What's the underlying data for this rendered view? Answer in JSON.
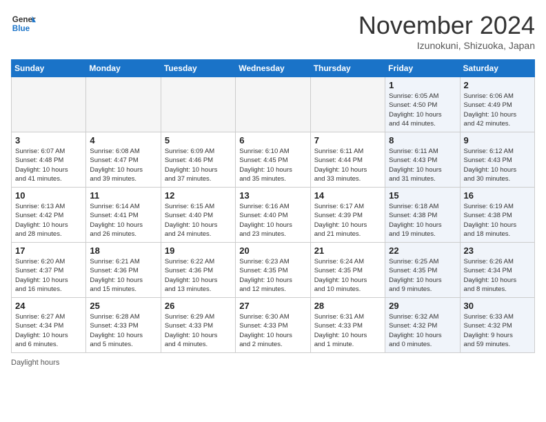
{
  "header": {
    "logo_line1": "General",
    "logo_line2": "Blue",
    "month": "November 2024",
    "location": "Izunokuni, Shizuoka, Japan"
  },
  "weekdays": [
    "Sunday",
    "Monday",
    "Tuesday",
    "Wednesday",
    "Thursday",
    "Friday",
    "Saturday"
  ],
  "weeks": [
    [
      {
        "day": "",
        "info": "",
        "empty": true
      },
      {
        "day": "",
        "info": "",
        "empty": true
      },
      {
        "day": "",
        "info": "",
        "empty": true
      },
      {
        "day": "",
        "info": "",
        "empty": true
      },
      {
        "day": "",
        "info": "",
        "empty": true
      },
      {
        "day": "1",
        "info": "Sunrise: 6:05 AM\nSunset: 4:50 PM\nDaylight: 10 hours\nand 44 minutes.",
        "shaded": true
      },
      {
        "day": "2",
        "info": "Sunrise: 6:06 AM\nSunset: 4:49 PM\nDaylight: 10 hours\nand 42 minutes.",
        "shaded": true
      }
    ],
    [
      {
        "day": "3",
        "info": "Sunrise: 6:07 AM\nSunset: 4:48 PM\nDaylight: 10 hours\nand 41 minutes."
      },
      {
        "day": "4",
        "info": "Sunrise: 6:08 AM\nSunset: 4:47 PM\nDaylight: 10 hours\nand 39 minutes."
      },
      {
        "day": "5",
        "info": "Sunrise: 6:09 AM\nSunset: 4:46 PM\nDaylight: 10 hours\nand 37 minutes."
      },
      {
        "day": "6",
        "info": "Sunrise: 6:10 AM\nSunset: 4:45 PM\nDaylight: 10 hours\nand 35 minutes."
      },
      {
        "day": "7",
        "info": "Sunrise: 6:11 AM\nSunset: 4:44 PM\nDaylight: 10 hours\nand 33 minutes."
      },
      {
        "day": "8",
        "info": "Sunrise: 6:11 AM\nSunset: 4:43 PM\nDaylight: 10 hours\nand 31 minutes.",
        "shaded": true
      },
      {
        "day": "9",
        "info": "Sunrise: 6:12 AM\nSunset: 4:43 PM\nDaylight: 10 hours\nand 30 minutes.",
        "shaded": true
      }
    ],
    [
      {
        "day": "10",
        "info": "Sunrise: 6:13 AM\nSunset: 4:42 PM\nDaylight: 10 hours\nand 28 minutes."
      },
      {
        "day": "11",
        "info": "Sunrise: 6:14 AM\nSunset: 4:41 PM\nDaylight: 10 hours\nand 26 minutes."
      },
      {
        "day": "12",
        "info": "Sunrise: 6:15 AM\nSunset: 4:40 PM\nDaylight: 10 hours\nand 24 minutes."
      },
      {
        "day": "13",
        "info": "Sunrise: 6:16 AM\nSunset: 4:40 PM\nDaylight: 10 hours\nand 23 minutes."
      },
      {
        "day": "14",
        "info": "Sunrise: 6:17 AM\nSunset: 4:39 PM\nDaylight: 10 hours\nand 21 minutes."
      },
      {
        "day": "15",
        "info": "Sunrise: 6:18 AM\nSunset: 4:38 PM\nDaylight: 10 hours\nand 19 minutes.",
        "shaded": true
      },
      {
        "day": "16",
        "info": "Sunrise: 6:19 AM\nSunset: 4:38 PM\nDaylight: 10 hours\nand 18 minutes.",
        "shaded": true
      }
    ],
    [
      {
        "day": "17",
        "info": "Sunrise: 6:20 AM\nSunset: 4:37 PM\nDaylight: 10 hours\nand 16 minutes."
      },
      {
        "day": "18",
        "info": "Sunrise: 6:21 AM\nSunset: 4:36 PM\nDaylight: 10 hours\nand 15 minutes."
      },
      {
        "day": "19",
        "info": "Sunrise: 6:22 AM\nSunset: 4:36 PM\nDaylight: 10 hours\nand 13 minutes."
      },
      {
        "day": "20",
        "info": "Sunrise: 6:23 AM\nSunset: 4:35 PM\nDaylight: 10 hours\nand 12 minutes."
      },
      {
        "day": "21",
        "info": "Sunrise: 6:24 AM\nSunset: 4:35 PM\nDaylight: 10 hours\nand 10 minutes."
      },
      {
        "day": "22",
        "info": "Sunrise: 6:25 AM\nSunset: 4:35 PM\nDaylight: 10 hours\nand 9 minutes.",
        "shaded": true
      },
      {
        "day": "23",
        "info": "Sunrise: 6:26 AM\nSunset: 4:34 PM\nDaylight: 10 hours\nand 8 minutes.",
        "shaded": true
      }
    ],
    [
      {
        "day": "24",
        "info": "Sunrise: 6:27 AM\nSunset: 4:34 PM\nDaylight: 10 hours\nand 6 minutes."
      },
      {
        "day": "25",
        "info": "Sunrise: 6:28 AM\nSunset: 4:33 PM\nDaylight: 10 hours\nand 5 minutes."
      },
      {
        "day": "26",
        "info": "Sunrise: 6:29 AM\nSunset: 4:33 PM\nDaylight: 10 hours\nand 4 minutes."
      },
      {
        "day": "27",
        "info": "Sunrise: 6:30 AM\nSunset: 4:33 PM\nDaylight: 10 hours\nand 2 minutes."
      },
      {
        "day": "28",
        "info": "Sunrise: 6:31 AM\nSunset: 4:33 PM\nDaylight: 10 hours\nand 1 minute."
      },
      {
        "day": "29",
        "info": "Sunrise: 6:32 AM\nSunset: 4:32 PM\nDaylight: 10 hours\nand 0 minutes.",
        "shaded": true
      },
      {
        "day": "30",
        "info": "Sunrise: 6:33 AM\nSunset: 4:32 PM\nDaylight: 9 hours\nand 59 minutes.",
        "shaded": true
      }
    ]
  ],
  "footer": "Daylight hours"
}
